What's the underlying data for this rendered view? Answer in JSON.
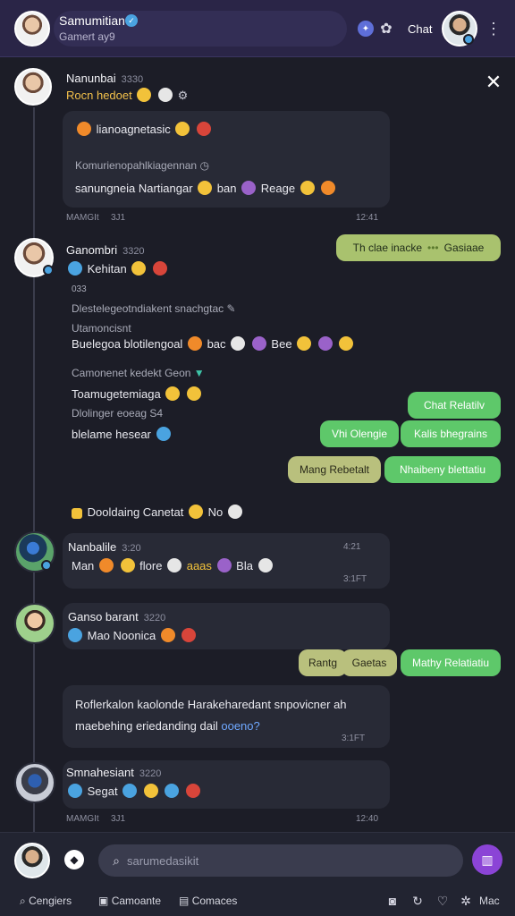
{
  "header": {
    "name": "Samumitian",
    "subtitle": "Gamert ay9",
    "chat_label": "Chat",
    "icons": [
      "verified-icon",
      "spark-icon",
      "puzzle-icon",
      "more-icon"
    ]
  },
  "thread": {
    "close_icon": "close-icon",
    "messages": [
      {
        "name": "Nanunbai",
        "time": "3330",
        "line1": "Rocn hedoet",
        "card_line1": "lianoagnetasic",
        "card_line2": "Komurienopahlkiagennan",
        "card_line3a": "sanungneia Nartiangar",
        "card_line3b": "ban",
        "card_line3c": "Reage",
        "meta_left": "MAMGIt",
        "meta_mid": "3J1",
        "meta_right": "12:41"
      },
      {
        "name": "Ganombri",
        "time": "3320",
        "line1": "Kehitan",
        "small": "033",
        "line2": "Dlestelegeotndiakent snachgtac",
        "line3": "Utamoncisnt",
        "line4a": "Buelegoa blotilengoal",
        "line4b": "bac",
        "line4c": "Bee",
        "line5": "Camonenet kedekt Geon",
        "line6": "Toamugetemiaga",
        "line7": "Dlolinger eoeag",
        "line7b": "S4",
        "line8": "blelame hesear"
      },
      {
        "name": "Nanbalile",
        "time": "3:20",
        "line1a": "Man",
        "line1b": "flore",
        "line1c": "aaas",
        "line1d": "Bla",
        "meta_right1": "4:21",
        "meta_right2": "3:1FT"
      },
      {
        "name": "Ganso barant",
        "time": "3220",
        "line1": "Mao Noonica"
      },
      {
        "card_line1": "Roflerkalon kaolonde Harakeharedant snpovicner ah",
        "card_line2a": "maebehing eriedanding dail",
        "card_line2b": "ooeno?",
        "meta_right": "3:1FT"
      },
      {
        "name": "Smnahesiant",
        "time": "3220",
        "line1": "Segat",
        "meta_left": "MAMGIt",
        "meta_mid": "3J1",
        "meta_right": "12:40"
      }
    ],
    "system_note": "Dooldaing Canetat",
    "system_note_suffix": "No"
  },
  "bubbles": {
    "b1a": "Th clae inacke",
    "b1b": "Gasiaae",
    "b2": "Chat Relatilv",
    "b3": "Vhi Olengie",
    "b4": "Kalis bhegrains",
    "b5": "Mang Rebetalt",
    "b6": "Nhaibeny blettatiu",
    "b7": "Rantg",
    "b8": "Gaetas",
    "b9": "Mathy Relatiatiu"
  },
  "composer": {
    "placeholder": "sarumedasikit"
  },
  "bottom_nav": {
    "items": [
      "Cengiers",
      "Camoante",
      "Comaces"
    ],
    "right_label": "Mac"
  },
  "colors": {
    "background": "#1c1d27",
    "header": "#2a2547",
    "accent_purple": "#8b44d6",
    "bubble_green": "#5ec86a",
    "bubble_olive": "#a9c26e"
  }
}
